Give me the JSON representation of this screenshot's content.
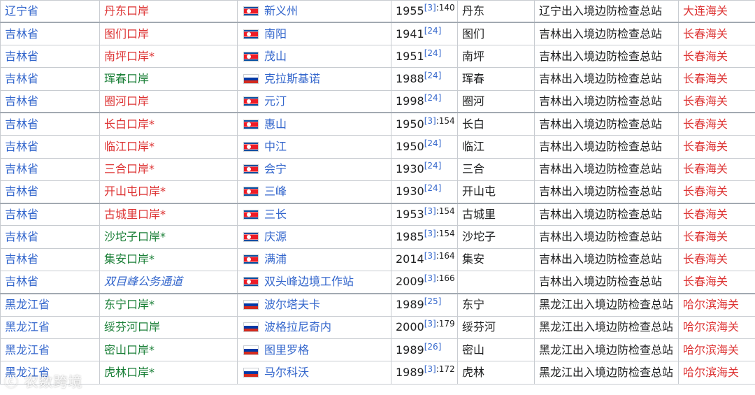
{
  "rows": [
    {
      "province": "辽宁省",
      "port": "丹东口岸",
      "port_color": "red",
      "port_italic": false,
      "flag": "kp",
      "city": "新义州",
      "year": "1955",
      "ref": "[3]",
      "page": ":140",
      "domestic": "丹东",
      "station": "辽宁出入境边防检查总站",
      "customs": "大连海关",
      "group_start": false
    },
    {
      "province": "吉林省",
      "port": "图们口岸",
      "port_color": "red",
      "port_italic": false,
      "flag": "kp",
      "city": "南阳",
      "year": "1941",
      "ref": "[24]",
      "page": "",
      "domestic": "图们",
      "station": "吉林出入境边防检查总站",
      "customs": "长春海关",
      "group_start": true
    },
    {
      "province": "吉林省",
      "port": "南坪口岸*",
      "port_color": "red",
      "port_italic": false,
      "flag": "kp",
      "city": "茂山",
      "year": "1951",
      "ref": "[24]",
      "page": "",
      "domestic": "南坪",
      "station": "吉林出入境边防检查总站",
      "customs": "长春海关",
      "group_start": false
    },
    {
      "province": "吉林省",
      "port": "珲春口岸",
      "port_color": "green",
      "port_italic": false,
      "flag": "ru",
      "city": "克拉斯基诺",
      "year": "1988",
      "ref": "[24]",
      "page": "",
      "domestic": "珲春",
      "station": "吉林出入境边防检查总站",
      "customs": "长春海关",
      "group_start": false
    },
    {
      "province": "吉林省",
      "port": "圈河口岸",
      "port_color": "red",
      "port_italic": false,
      "flag": "kp",
      "city": "元汀",
      "year": "1998",
      "ref": "[24]",
      "page": "",
      "domestic": "圈河",
      "station": "吉林出入境边防检查总站",
      "customs": "长春海关",
      "group_start": false
    },
    {
      "province": "吉林省",
      "port": "长白口岸*",
      "port_color": "red",
      "port_italic": false,
      "flag": "kp",
      "city": "惠山",
      "year": "1950",
      "ref": "[3]",
      "page": ":154",
      "domestic": "长白",
      "station": "吉林出入境边防检查总站",
      "customs": "长春海关",
      "group_start": true
    },
    {
      "province": "吉林省",
      "port": "临江口岸*",
      "port_color": "red",
      "port_italic": false,
      "flag": "kp",
      "city": "中江",
      "year": "1950",
      "ref": "[24]",
      "page": "",
      "domestic": "临江",
      "station": "吉林出入境边防检查总站",
      "customs": "长春海关",
      "group_start": false
    },
    {
      "province": "吉林省",
      "port": "三合口岸*",
      "port_color": "red",
      "port_italic": false,
      "flag": "kp",
      "city": "会宁",
      "year": "1930",
      "ref": "[24]",
      "page": "",
      "domestic": "三合",
      "station": "吉林出入境边防检查总站",
      "customs": "长春海关",
      "group_start": false
    },
    {
      "province": "吉林省",
      "port": "开山屯口岸*",
      "port_color": "red",
      "port_italic": false,
      "flag": "kp",
      "city": "三峰",
      "year": "1930",
      "ref": "[24]",
      "page": "",
      "domestic": "开山屯",
      "station": "吉林出入境边防检查总站",
      "customs": "长春海关",
      "group_start": false
    },
    {
      "province": "吉林省",
      "port": "古城里口岸*",
      "port_color": "red",
      "port_italic": false,
      "flag": "kp",
      "city": "三长",
      "year": "1953",
      "ref": "[3]",
      "page": ":154",
      "domestic": "古城里",
      "station": "吉林出入境边防检查总站",
      "customs": "长春海关",
      "group_start": true
    },
    {
      "province": "吉林省",
      "port": "沙坨子口岸*",
      "port_color": "green",
      "port_italic": false,
      "flag": "kp",
      "city": "庆源",
      "year": "1985",
      "ref": "[3]",
      "page": ":154",
      "domestic": "沙坨子",
      "station": "吉林出入境边防检查总站",
      "customs": "长春海关",
      "group_start": false
    },
    {
      "province": "吉林省",
      "port": "集安口岸*",
      "port_color": "green",
      "port_italic": false,
      "flag": "kp",
      "city": "满浦",
      "year": "2014",
      "ref": "[3]",
      "page": ":164",
      "domestic": "集安",
      "station": "吉林出入境边防检查总站",
      "customs": "长春海关",
      "group_start": false
    },
    {
      "province": "吉林省",
      "port": "双目峰公务通道",
      "port_color": "blue",
      "port_italic": true,
      "flag": "kp",
      "city": "双头峰边境工作站",
      "year": "2009",
      "ref": "[3]",
      "page": ":166",
      "domestic": "",
      "station": "吉林出入境边防检查总站",
      "customs": "长春海关",
      "group_start": false
    },
    {
      "province": "黑龙江省",
      "port": "东宁口岸*",
      "port_color": "green",
      "port_italic": false,
      "flag": "ru",
      "city": "波尔塔夫卡",
      "year": "1989",
      "ref": "[25]",
      "page": "",
      "domestic": "东宁",
      "station": "黑龙江出入境边防检查总站",
      "customs": "哈尔滨海关",
      "group_start": true
    },
    {
      "province": "黑龙江省",
      "port": "绥芬河口岸",
      "port_color": "green",
      "port_italic": false,
      "flag": "ru",
      "city": "波格拉尼奇内",
      "year": "2000",
      "ref": "[3]",
      "page": ":179",
      "domestic": "绥芬河",
      "station": "黑龙江出入境边防检查总站",
      "customs": "哈尔滨海关",
      "group_start": false
    },
    {
      "province": "黑龙江省",
      "port": "密山口岸*",
      "port_color": "green",
      "port_italic": false,
      "flag": "ru",
      "city": "图里罗格",
      "year": "1989",
      "ref": "[26]",
      "page": "",
      "domestic": "密山",
      "station": "黑龙江出入境边防检查总站",
      "customs": "哈尔滨海关",
      "group_start": false
    },
    {
      "province": "黑龙江省",
      "port": "虎林口岸*",
      "port_color": "green",
      "port_italic": false,
      "flag": "ru",
      "city": "马尔科沃",
      "year": "1989",
      "ref": "[3]",
      "page": ":172",
      "domestic": "虎林",
      "station": "黑龙江出入境边防检查总站",
      "customs": "哈尔滨海关",
      "group_start": false
    }
  ],
  "flags": {
    "kp": {
      "icon": "north-korea-flag-icon"
    },
    "ru": {
      "icon": "russia-flag-icon"
    }
  },
  "watermark": "ⓒ 农数跨境",
  "colors": {
    "link_blue": "#3366cc",
    "link_red": "#dd3333",
    "link_green": "#1a7f37",
    "border": "#c8ccd1"
  }
}
